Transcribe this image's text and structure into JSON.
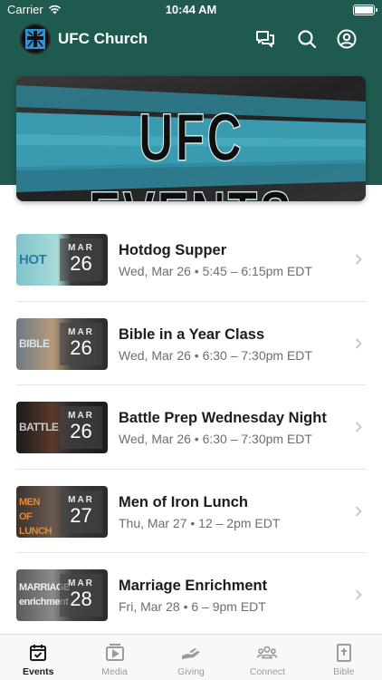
{
  "status_bar": {
    "carrier": "Carrier",
    "time": "10:44 AM"
  },
  "header": {
    "title": "UFC Church"
  },
  "banner": {
    "title": "UFC EVENTS"
  },
  "events": [
    {
      "title": "Hotdog Supper",
      "meta": "Wed, Mar 26 • 5:45 – 6:15pm EDT",
      "month": "MAR",
      "day": "26",
      "art_text": "HOT"
    },
    {
      "title": "Bible in a Year Class",
      "meta": "Wed, Mar 26 • 6:30 – 7:30pm EDT",
      "month": "MAR",
      "day": "26",
      "art_text": "BIBLE"
    },
    {
      "title": "Battle Prep Wednesday Night",
      "meta": "Wed, Mar 26 • 6:30 – 7:30pm EDT",
      "month": "MAR",
      "day": "26",
      "art_text": "BATTLE"
    },
    {
      "title": "Men of Iron Lunch",
      "meta": "Thu, Mar 27 • 12 – 2pm EDT",
      "month": "MAR",
      "day": "27",
      "art_text": "MEN OF LUNCH"
    },
    {
      "title": "Marriage Enrichment",
      "meta": "Fri, Mar 28 • 6 – 9pm EDT",
      "month": "MAR",
      "day": "28",
      "art_text": "MARRIAGE enrichment"
    }
  ],
  "tabs": [
    {
      "label": "Events",
      "icon": "calendar-check-icon",
      "active": true
    },
    {
      "label": "Media",
      "icon": "play-square-icon",
      "active": false
    },
    {
      "label": "Giving",
      "icon": "giving-hand-icon",
      "active": false
    },
    {
      "label": "Connect",
      "icon": "people-group-icon",
      "active": false
    },
    {
      "label": "Bible",
      "icon": "bible-book-icon",
      "active": false
    }
  ],
  "colors": {
    "header_bg": "#1f5a50",
    "banner_teal": "#3a9ab0",
    "text_primary": "#1c1c1e",
    "text_secondary": "#6d6d72"
  }
}
